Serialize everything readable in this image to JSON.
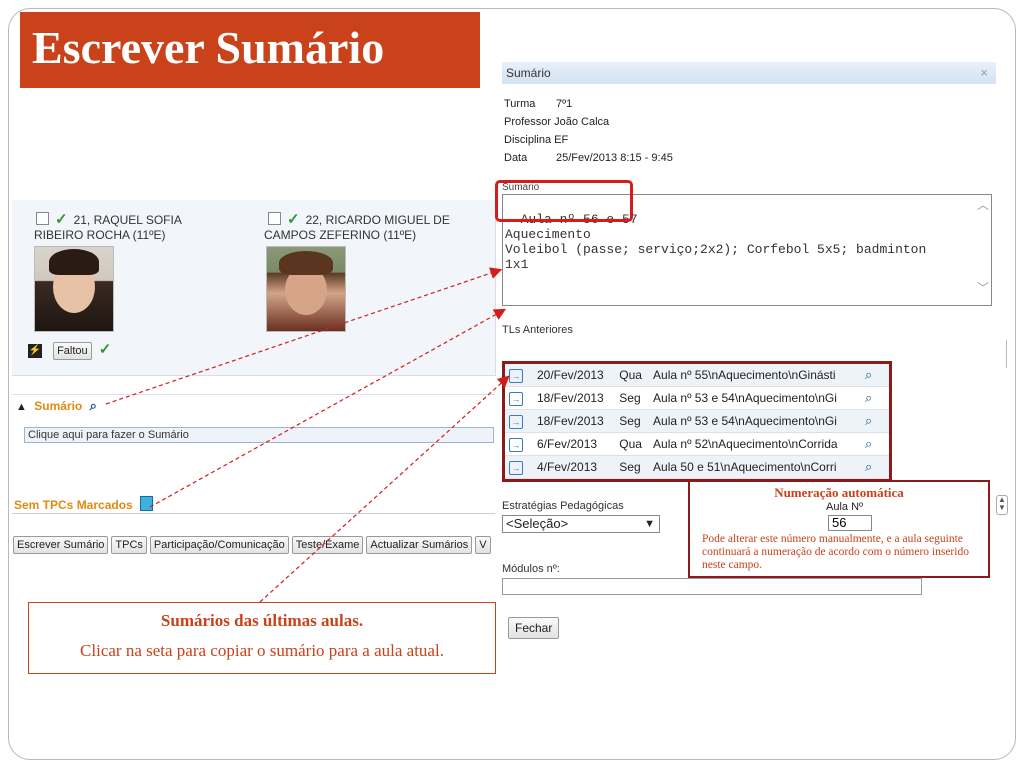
{
  "slide": {
    "title": "Escrever Sumário"
  },
  "students": [
    {
      "number_name": "21, RAQUEL SOFIA",
      "name_cont": "RIBEIRO ROCHA (11ºE)"
    },
    {
      "number_name": "22, RICARDO MIGUEL DE",
      "name_cont": "CAMPOS ZEFERINO (11ºE)"
    }
  ],
  "faltou_label": "Faltou",
  "sumario_section": {
    "header": "Sumário",
    "input_placeholder": "Clique aqui para fazer o Sumário"
  },
  "tpc_section": {
    "header": "Sem TPCs Marcados"
  },
  "bottom_buttons": [
    "Escrever Sumário",
    "TPCs",
    "Participação/Comunicação",
    "Teste/Exame",
    "Actualizar Sumários",
    "V"
  ],
  "callout_left": {
    "title": "Sumários das últimas aulas.",
    "text": "Clicar na seta para copiar o sumário para a aula atual."
  },
  "dialog": {
    "title": "Sumário",
    "close_glyph": "×",
    "info": [
      {
        "label": "Turma",
        "value": "7º1"
      },
      {
        "label": "Professor",
        "value": "João Calca"
      },
      {
        "label": "Disciplina",
        "value": "EF"
      },
      {
        "label": "Data",
        "value": "25/Fev/2013 8:15 - 9:45"
      }
    ],
    "sumario_label": "Sumario",
    "sumario_text": "Aula nº 56 e 57\nAquecimento\nVoleibol (passe; serviço;2x2); Corfebol 5x5; badminton\n1x1",
    "tls_label": "TLs Anteriores",
    "tls_rows": [
      {
        "date": "20/Fev/2013",
        "day": "Qua",
        "summary": "Aula nº 55\\nAquecimento\\nGinásti"
      },
      {
        "date": "18/Fev/2013",
        "day": "Seg",
        "summary": "Aula nº 53 e 54\\nAquecimento\\nGi"
      },
      {
        "date": "18/Fev/2013",
        "day": "Seg",
        "summary": "Aula nº 53 e 54\\nAquecimento\\nGi"
      },
      {
        "date": "6/Fev/2013",
        "day": "Qua",
        "summary": "Aula nº 52\\nAquecimento\\nCorrida"
      },
      {
        "date": "4/Fev/2013",
        "day": "Seg",
        "summary": "Aula 50 e 51\\nAquecimento\\nCorri"
      }
    ],
    "estrategias_label": "Estratégias Pedagógicas",
    "estrategias_value": "<Seleção>",
    "modulos_label": "Módulos nº:",
    "fechar_label": "Fechar"
  },
  "callout_right": {
    "title": "Numeração automática",
    "aula_label": "Aula Nº",
    "aula_value": "56",
    "text": "Pode alterar este número manualmente, e a aula seguinte continuará a numeração de acordo com o número inserido neste campo."
  },
  "colors": {
    "title_bg": "#c9421a",
    "accent_orange": "#e08a12",
    "callout_border": "#8b1a1a",
    "highlight_red": "#d41c1c"
  }
}
